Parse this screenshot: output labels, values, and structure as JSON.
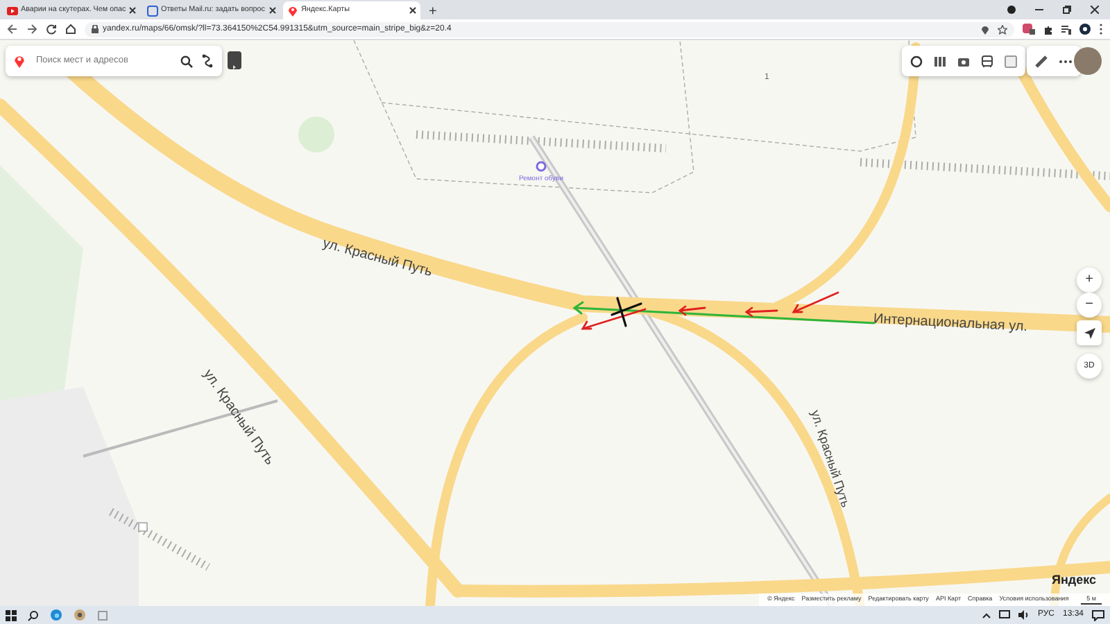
{
  "browser": {
    "tabs": [
      {
        "title": "Аварии на скутерах. Чем опас",
        "selected": false
      },
      {
        "title": "Ответы Mail.ru: задать вопрос",
        "selected": false
      },
      {
        "title": "Яндекс.Карты",
        "selected": true
      }
    ],
    "new_tab": "+",
    "url": "yandex.ru/maps/66/omsk/?ll=73.364150%2C54.991315&utm_source=main_stripe_big&z=20.4"
  },
  "map": {
    "search": {
      "placeholder": "Поиск мест и адресов"
    },
    "streets": [
      {
        "text": "ул. Красный Путь"
      },
      {
        "text": "ул. Красный Путь"
      },
      {
        "text": "ул. Красный Путь"
      },
      {
        "text": "Интернациональная ул."
      }
    ],
    "poi": {
      "label": "Ремонт обуви"
    },
    "building_number": "1",
    "zoom_in": "+",
    "zoom_out": "−",
    "view_3d": "3D",
    "logo": "Яндекс",
    "footer_links": [
      "© Яндекс",
      "Разместить рекламу",
      "Редактировать карту",
      "API Карт",
      "Справка",
      "Условия использования"
    ],
    "scale": "5 м"
  },
  "taskbar": {
    "language": "РУС",
    "time": "13:34"
  }
}
